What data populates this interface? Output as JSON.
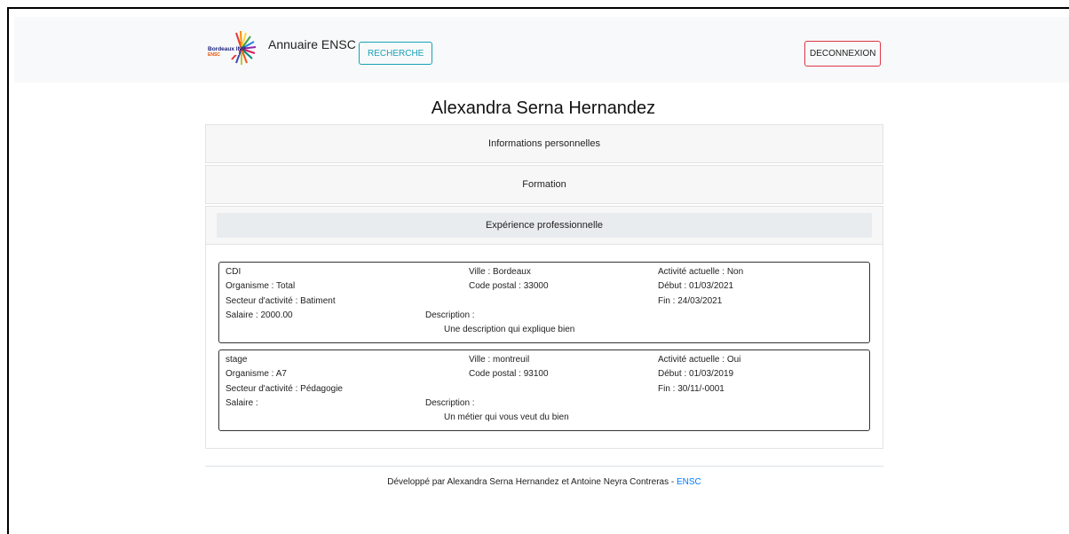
{
  "header": {
    "logo_text": "Bordeaux INP ENSC",
    "brand": "Annuaire ENSC",
    "search_button": "RECHERCHE",
    "logout_button": "DECONNEXION"
  },
  "page": {
    "title": "Alexandra Serna Hernandez"
  },
  "sections": {
    "personal": "Informations personnelles",
    "formation": "Formation",
    "experience": "Expérience professionnelle"
  },
  "experiences": [
    {
      "type": "CDI",
      "organisme": "Organisme : Total",
      "secteur": "Secteur d'activité : Batiment",
      "salaire": "Salaire : 2000.00",
      "ville": "Ville : Bordeaux",
      "code_postal": "Code postal : 33000",
      "activite": "Activité actuelle : Non",
      "debut": "Début : 01/03/2021",
      "fin": "Fin : 24/03/2021",
      "description_label": "Description :",
      "description": "Une description qui explique bien"
    },
    {
      "type": "stage",
      "organisme": "Organisme : A7",
      "secteur": "Secteur d'activité : Pédagogie",
      "salaire": "Salaire :",
      "ville": "Ville : montreuil",
      "code_postal": "Code postal : 93100",
      "activite": "Activité actuelle : Oui",
      "debut": "Début : 01/03/2019",
      "fin": "Fin : 30/11/-0001",
      "description_label": "Description :",
      "description": "Un métier qui vous veut du bien"
    }
  ],
  "footer": {
    "text": "Développé par Alexandra Serna Hernandez et Antoine Neyra Contreras - ",
    "link": "ENSC"
  },
  "colors": {
    "search_border": "#17a2b8",
    "logout_border": "#dc3545",
    "link": "#007bff"
  }
}
